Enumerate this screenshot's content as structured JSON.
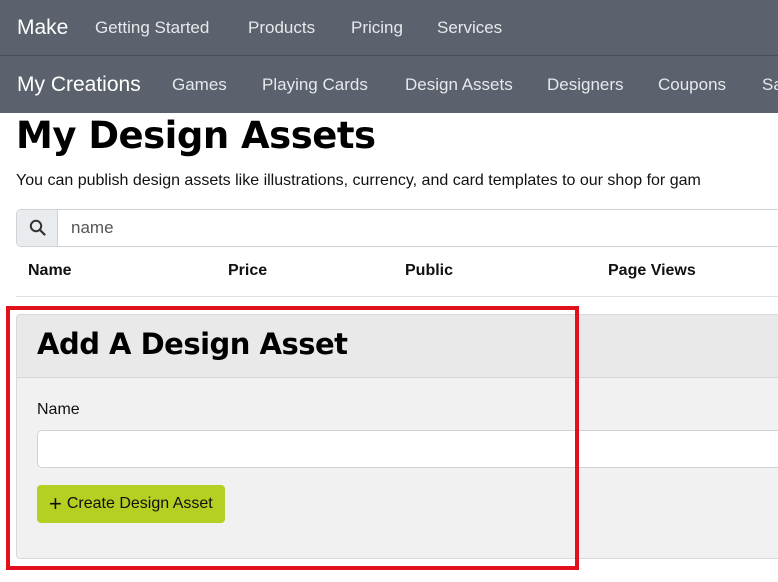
{
  "top_nav": {
    "brand": "Make",
    "items": [
      "Getting Started",
      "Products",
      "Pricing",
      "Services"
    ]
  },
  "sub_nav": {
    "brand": "My Creations",
    "items": [
      "Games",
      "Playing Cards",
      "Design Assets",
      "Designers",
      "Coupons",
      "Sa"
    ]
  },
  "page": {
    "title": "My Design Assets",
    "intro": "You can publish design assets like illustrations, currency, and card templates to our shop for gam"
  },
  "search": {
    "icon": "search-icon",
    "placeholder": "name"
  },
  "table": {
    "columns": [
      "Name",
      "Price",
      "Public",
      "Page Views"
    ]
  },
  "add_card": {
    "title": "Add A Design Asset",
    "name_label": "Name",
    "name_value": "",
    "button_icon": "+",
    "button_label": "Create Design Asset"
  },
  "colors": {
    "nav_bg": "#5b626d",
    "accent": "#b5cf22",
    "highlight": "#e0111a"
  }
}
